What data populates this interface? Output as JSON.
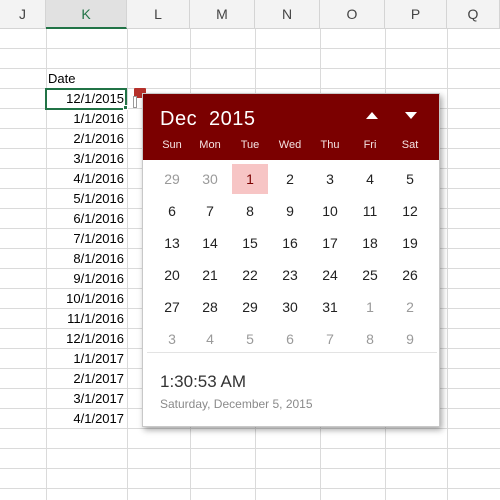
{
  "spreadsheet": {
    "columns": [
      "J",
      "K",
      "L",
      "M",
      "N",
      "O",
      "P",
      "Q"
    ],
    "active_column": "K",
    "header_cell": "Date",
    "dates": [
      "12/1/2015",
      "1/1/2016",
      "2/1/2016",
      "3/1/2016",
      "4/1/2016",
      "5/1/2016",
      "6/1/2016",
      "7/1/2016",
      "8/1/2016",
      "9/1/2016",
      "10/1/2016",
      "11/1/2016",
      "12/1/2016",
      "1/1/2017",
      "2/1/2017",
      "3/1/2017",
      "4/1/2017"
    ]
  },
  "picker": {
    "month": "Dec",
    "year": "2015",
    "prev_icon": "triangle-up-icon",
    "next_icon": "triangle-down-icon",
    "weekdays": [
      "Sun",
      "Mon",
      "Tue",
      "Wed",
      "Thu",
      "Fri",
      "Sat"
    ],
    "weeks": [
      [
        "29",
        "30",
        "1",
        "2",
        "3",
        "4",
        "5"
      ],
      [
        "6",
        "7",
        "8",
        "9",
        "10",
        "11",
        "12"
      ],
      [
        "13",
        "14",
        "15",
        "16",
        "17",
        "18",
        "19"
      ],
      [
        "20",
        "21",
        "22",
        "23",
        "24",
        "25",
        "26"
      ],
      [
        "27",
        "28",
        "29",
        "30",
        "31",
        "1",
        "2"
      ],
      [
        "3",
        "4",
        "5",
        "6",
        "7",
        "8",
        "9"
      ]
    ],
    "muted": [
      [
        true,
        true,
        false,
        false,
        false,
        false,
        false
      ],
      [
        false,
        false,
        false,
        false,
        false,
        false,
        false
      ],
      [
        false,
        false,
        false,
        false,
        false,
        false,
        false
      ],
      [
        false,
        false,
        false,
        false,
        false,
        false,
        false
      ],
      [
        false,
        false,
        false,
        false,
        false,
        true,
        true
      ],
      [
        true,
        true,
        true,
        true,
        true,
        true,
        true
      ]
    ],
    "selected_day": "1",
    "time": "1:30:53 AM",
    "long_date": "Saturday, December 5, 2015"
  },
  "colors": {
    "header_bg": "#7b0000",
    "selected_bg": "#f7c5c5",
    "excel_green": "#217346"
  }
}
